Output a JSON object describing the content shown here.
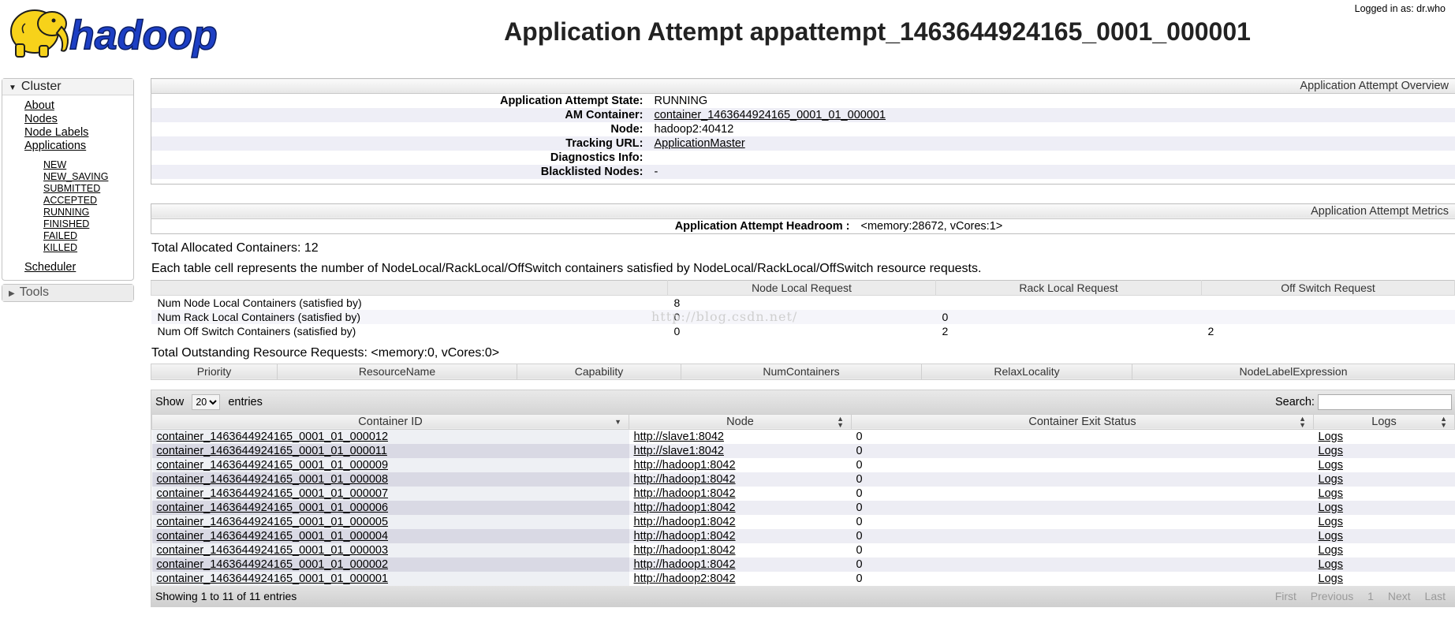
{
  "header": {
    "logo_text": "hadoop",
    "title": "Application Attempt appattempt_1463644924165_0001_000001",
    "logged_in": "Logged in as: dr.who"
  },
  "nav": {
    "cluster_label": "Cluster",
    "cluster_links": [
      "About",
      "Nodes",
      "Node Labels",
      "Applications"
    ],
    "app_states": [
      "NEW",
      "NEW_SAVING",
      "SUBMITTED",
      "ACCEPTED",
      "RUNNING",
      "FINISHED",
      "FAILED",
      "KILLED"
    ],
    "scheduler": "Scheduler",
    "tools_label": "Tools"
  },
  "overview": {
    "caption": "Application Attempt Overview",
    "rows": [
      {
        "key": "Application Attempt State:",
        "value": "RUNNING",
        "link": false
      },
      {
        "key": "AM Container:",
        "value": "container_1463644924165_0001_01_000001",
        "link": true
      },
      {
        "key": "Node:",
        "value": "hadoop2:40412",
        "link": false
      },
      {
        "key": "Tracking URL:",
        "value": "ApplicationMaster",
        "link": true
      },
      {
        "key": "Diagnostics Info:",
        "value": "",
        "link": false
      },
      {
        "key": "Blacklisted Nodes:",
        "value": "-",
        "link": false
      }
    ]
  },
  "metrics": {
    "caption": "Application Attempt Metrics",
    "headroom_key": "Application Attempt Headroom :",
    "headroom_value": "<memory:28672, vCores:1>"
  },
  "allocated": {
    "total": "Total Allocated Containers: 12",
    "description": "Each table cell represents the number of NodeLocal/RackLocal/OffSwitch containers satisfied by NodeLocal/RackLocal/OffSwitch resource requests.",
    "headers": [
      "",
      "Node Local Request",
      "Rack Local Request",
      "Off Switch Request"
    ],
    "rows": [
      [
        "Num Node Local Containers (satisfied by)",
        "8",
        "",
        ""
      ],
      [
        "Num Rack Local Containers (satisfied by)",
        "0",
        "0",
        ""
      ],
      [
        "Num Off Switch Containers (satisfied by)",
        "0",
        "2",
        "2"
      ]
    ]
  },
  "outstanding": {
    "total": "Total Outstanding Resource Requests: <memory:0, vCores:0>",
    "headers": [
      "Priority",
      "ResourceName",
      "Capability",
      "NumContainers",
      "RelaxLocality",
      "NodeLabelExpression"
    ]
  },
  "containers": {
    "show_label": "Show",
    "page_size": "20",
    "entries_label": "entries",
    "search_label": "Search:",
    "headers": [
      "Container ID",
      "Node",
      "Container Exit Status",
      "Logs"
    ],
    "rows": [
      [
        "container_1463644924165_0001_01_000012",
        "http://slave1:8042",
        "0",
        "Logs"
      ],
      [
        "container_1463644924165_0001_01_000011",
        "http://slave1:8042",
        "0",
        "Logs"
      ],
      [
        "container_1463644924165_0001_01_000009",
        "http://hadoop1:8042",
        "0",
        "Logs"
      ],
      [
        "container_1463644924165_0001_01_000008",
        "http://hadoop1:8042",
        "0",
        "Logs"
      ],
      [
        "container_1463644924165_0001_01_000007",
        "http://hadoop1:8042",
        "0",
        "Logs"
      ],
      [
        "container_1463644924165_0001_01_000006",
        "http://hadoop1:8042",
        "0",
        "Logs"
      ],
      [
        "container_1463644924165_0001_01_000005",
        "http://hadoop1:8042",
        "0",
        "Logs"
      ],
      [
        "container_1463644924165_0001_01_000004",
        "http://hadoop1:8042",
        "0",
        "Logs"
      ],
      [
        "container_1463644924165_0001_01_000003",
        "http://hadoop1:8042",
        "0",
        "Logs"
      ],
      [
        "container_1463644924165_0001_01_000002",
        "http://hadoop1:8042",
        "0",
        "Logs"
      ],
      [
        "container_1463644924165_0001_01_000001",
        "http://hadoop2:8042",
        "0",
        "Logs"
      ]
    ],
    "footer": "Showing 1 to 11 of 11 entries",
    "pager": [
      "First",
      "Previous",
      "1",
      "Next",
      "Last"
    ]
  },
  "watermark": "http://blog.csdn.net/",
  "colors": {
    "logo_blue": "#1d3fc4",
    "logo_yellow": "#f7d21a",
    "row_alt": "#eeeef6"
  }
}
